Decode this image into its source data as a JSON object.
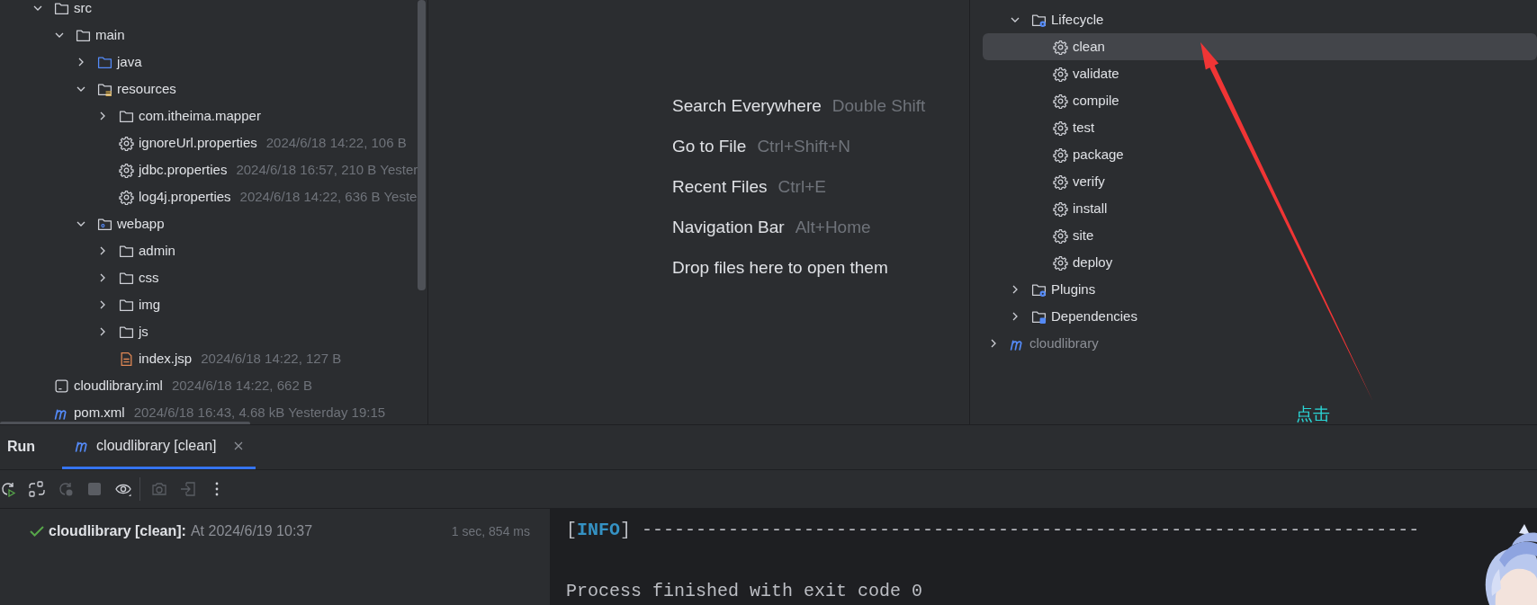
{
  "project_tree": [
    {
      "label": "src",
      "kind": "folder",
      "expanded": true,
      "children": [
        {
          "label": "main",
          "kind": "folder",
          "expanded": true,
          "children": [
            {
              "label": "java",
              "kind": "source-folder",
              "expanded": false
            },
            {
              "label": "resources",
              "kind": "resources-folder",
              "expanded": true,
              "children": [
                {
                  "label": "com.itheima.mapper",
                  "kind": "folder",
                  "expanded": false
                },
                {
                  "label": "ignoreUrl.properties",
                  "kind": "properties",
                  "meta": "2024/6/18 14:22, 106 B"
                },
                {
                  "label": "jdbc.properties",
                  "kind": "properties",
                  "meta": "2024/6/18 16:57, 210 B Yester"
                },
                {
                  "label": "log4j.properties",
                  "kind": "properties",
                  "meta": "2024/6/18 14:22, 636 B Yeste"
                }
              ]
            },
            {
              "label": "webapp",
              "kind": "web-folder",
              "expanded": true,
              "children": [
                {
                  "label": "admin",
                  "kind": "folder",
                  "expanded": false
                },
                {
                  "label": "css",
                  "kind": "folder",
                  "expanded": false
                },
                {
                  "label": "img",
                  "kind": "folder",
                  "expanded": false
                },
                {
                  "label": "js",
                  "kind": "folder",
                  "expanded": false
                },
                {
                  "label": "index.jsp",
                  "kind": "jsp",
                  "meta": "2024/6/18 14:22, 127 B"
                }
              ]
            }
          ]
        }
      ]
    },
    {
      "label": "cloudlibrary.iml",
      "kind": "iml",
      "meta": "2024/6/18 14:22, 662 B"
    },
    {
      "label": "pom.xml",
      "kind": "module",
      "meta": "2024/6/18 16:43, 4.68 kB Yesterday 19:15"
    }
  ],
  "welcome": {
    "actions": [
      {
        "label": "Search Everywhere",
        "shortcut": "Double Shift"
      },
      {
        "label": "Go to File",
        "shortcut": "Ctrl+Shift+N"
      },
      {
        "label": "Recent Files",
        "shortcut": "Ctrl+E"
      },
      {
        "label": "Navigation Bar",
        "shortcut": "Alt+Home"
      }
    ],
    "hint": "Drop files here to open them"
  },
  "maven_tree": [
    {
      "children": [
        {
          "label": "Lifecycle",
          "kind": "lifecycle",
          "expanded": true,
          "children": [
            {
              "label": "clean",
              "kind": "goal",
              "selected": true
            },
            {
              "label": "validate",
              "kind": "goal",
              "selected": false
            },
            {
              "label": "compile",
              "kind": "goal",
              "selected": false
            },
            {
              "label": "test",
              "kind": "goal",
              "selected": false
            },
            {
              "label": "package",
              "kind": "goal",
              "selected": false
            },
            {
              "label": "verify",
              "kind": "goal",
              "selected": false
            },
            {
              "label": "install",
              "kind": "goal",
              "selected": false
            },
            {
              "label": "site",
              "kind": "goal",
              "selected": false
            },
            {
              "label": "deploy",
              "kind": "goal",
              "selected": false
            }
          ]
        },
        {
          "label": "Plugins",
          "kind": "plugins",
          "expanded": false
        },
        {
          "label": "Dependencies",
          "kind": "dependencies",
          "expanded": false
        }
      ]
    },
    {
      "label": "cloudlibrary",
      "kind": "module",
      "expanded": false,
      "dim": true
    }
  ],
  "annotation": {
    "text": "点击"
  },
  "run_panel": {
    "title": "Run",
    "tabs": [
      {
        "label": "cloudlibrary [clean]",
        "selected": true
      }
    ],
    "toolbar": [
      {
        "kind": "rerun",
        "disabled": false
      },
      {
        "kind": "toggle",
        "disabled": false
      },
      {
        "kind": "rerun-failed",
        "disabled": true
      },
      {
        "kind": "stop",
        "disabled": true
      },
      {
        "kind": "view",
        "disabled": false
      },
      {
        "kind": "separator"
      },
      {
        "kind": "screenshot",
        "disabled": true
      },
      {
        "kind": "exit",
        "disabled": true
      },
      {
        "kind": "more",
        "disabled": false
      }
    ],
    "result": {
      "passed": true,
      "name": "cloudlibrary [clean]:",
      "detail": "At 2024/6/19 10:37",
      "duration": "1 sec, 854 ms"
    },
    "console": [
      {
        "kind": "log",
        "text": "[**INFO**] ------------------------------------------------------------------------"
      },
      {
        "kind": "blank"
      },
      {
        "kind": "log",
        "text": "Process finished with exit code 0"
      }
    ]
  }
}
